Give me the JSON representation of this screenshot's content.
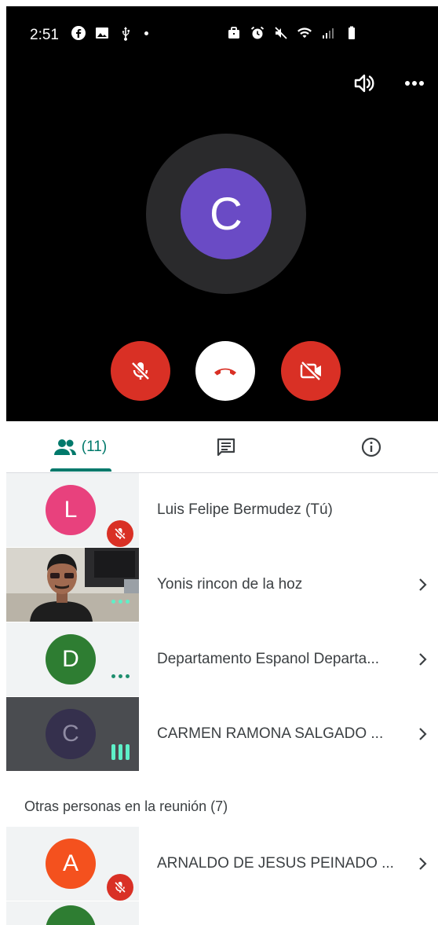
{
  "status_bar": {
    "time": "2:51"
  },
  "call": {
    "main_avatar_letter": "C",
    "colors": {
      "end_call": "#ffffff",
      "mute": "#d93025",
      "avatar": "#6a4bc5"
    }
  },
  "tabs": {
    "people_count": "(11)"
  },
  "participants": [
    {
      "initial": "L",
      "name": "Luis Felipe Bermudez (Tú)",
      "avatar_color": "#e8417d",
      "muted": true
    },
    {
      "initial": "",
      "name": "Yonis rincon de la hoz",
      "video": true
    },
    {
      "initial": "D",
      "name": "Departamento Espanol Departa...",
      "avatar_color": "#2e7d32"
    },
    {
      "initial": "C",
      "name": "CARMEN RAMONA SALGADO ...",
      "avatar_color": "#35304d",
      "speaking": true
    }
  ],
  "others_section": {
    "label": "Otras personas en la reunión (7)"
  },
  "others": [
    {
      "initial": "A",
      "name": "ARNALDO DE JESUS PEINADO ...",
      "avatar_color": "#f4511e",
      "muted": true
    }
  ]
}
